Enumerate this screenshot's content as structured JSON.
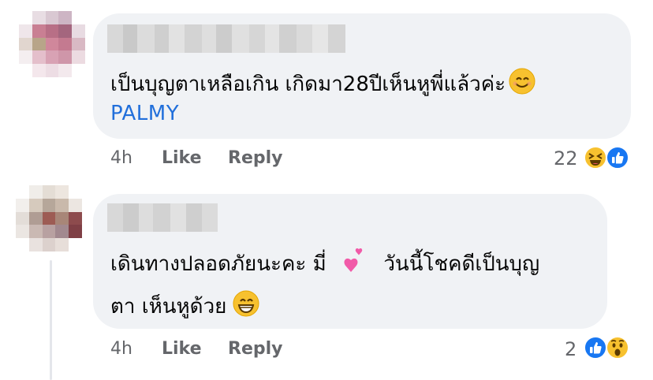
{
  "comments": [
    {
      "text": "เป็นบุญตาเหลือเกิน  เกิดมา28ปีเห็นหูพี่แล้วค่ะ",
      "emoji": "smiling-face-emoji",
      "tag": "PALMY",
      "time": "4h",
      "like_label": "Like",
      "reply_label": "Reply",
      "reaction_count": "22",
      "reactions": [
        "haha-reaction-icon",
        "like-reaction-icon"
      ]
    },
    {
      "line1_a": "เดินทางปลอดภัยนะคะ มี่",
      "line1_b": "วันนี้โชคดีเป็นบุญ",
      "line2": "ตา เห็นหูด้วย",
      "emoji1": "two-hearts-emoji",
      "emoji2": "grinning-face-emoji",
      "time": "4h",
      "like_label": "Like",
      "reply_label": "Reply",
      "reaction_count": "2",
      "reactions": [
        "like-reaction-icon",
        "wow-reaction-icon"
      ]
    }
  ],
  "colors": {
    "bubble": "#f0f2f5",
    "text": "#050505",
    "meta": "#65676b",
    "tag": "#216fdb",
    "like_blue": "#1877f2",
    "reaction_yellow": "#f7c12f"
  }
}
